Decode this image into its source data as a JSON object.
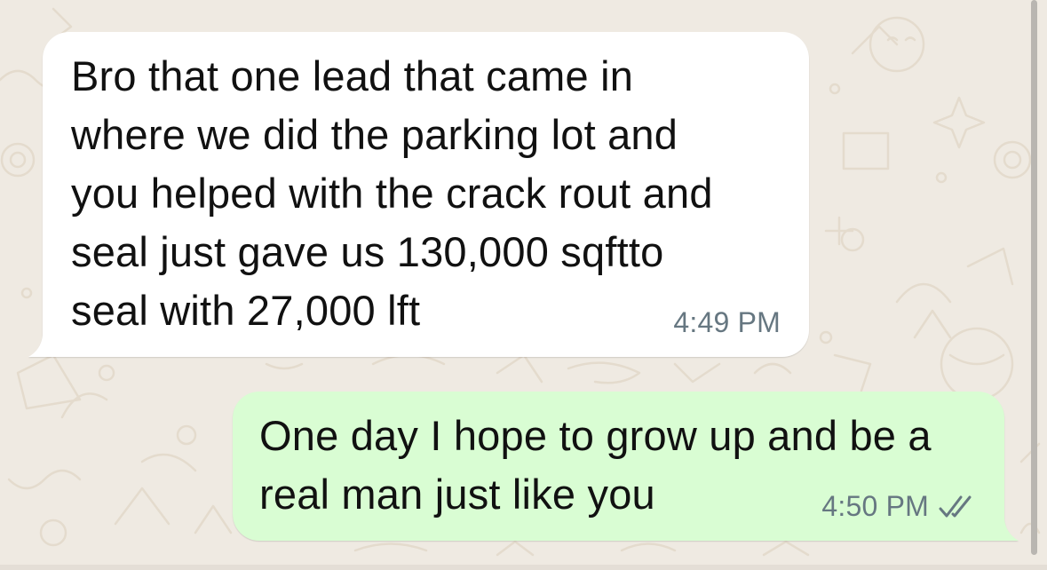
{
  "chat": {
    "messages": [
      {
        "direction": "incoming",
        "text": "Bro that one lead that came in\nwhere we did the parking lot and\nyou helped with the crack rout and\nseal just gave us 130,000 sqftto\nseal with 27,000 lft",
        "time": "4:49 PM"
      },
      {
        "direction": "outgoing",
        "text": "One day I hope to grow up and be a\nreal man just like you",
        "time": "4:50 PM",
        "status_icon": "double-check-icon"
      }
    ]
  },
  "colors": {
    "background": "#efeae2",
    "incoming_bubble": "#ffffff",
    "outgoing_bubble": "#d9fdd3",
    "timestamp": "#667781",
    "doodle": "#e2d9cb"
  }
}
